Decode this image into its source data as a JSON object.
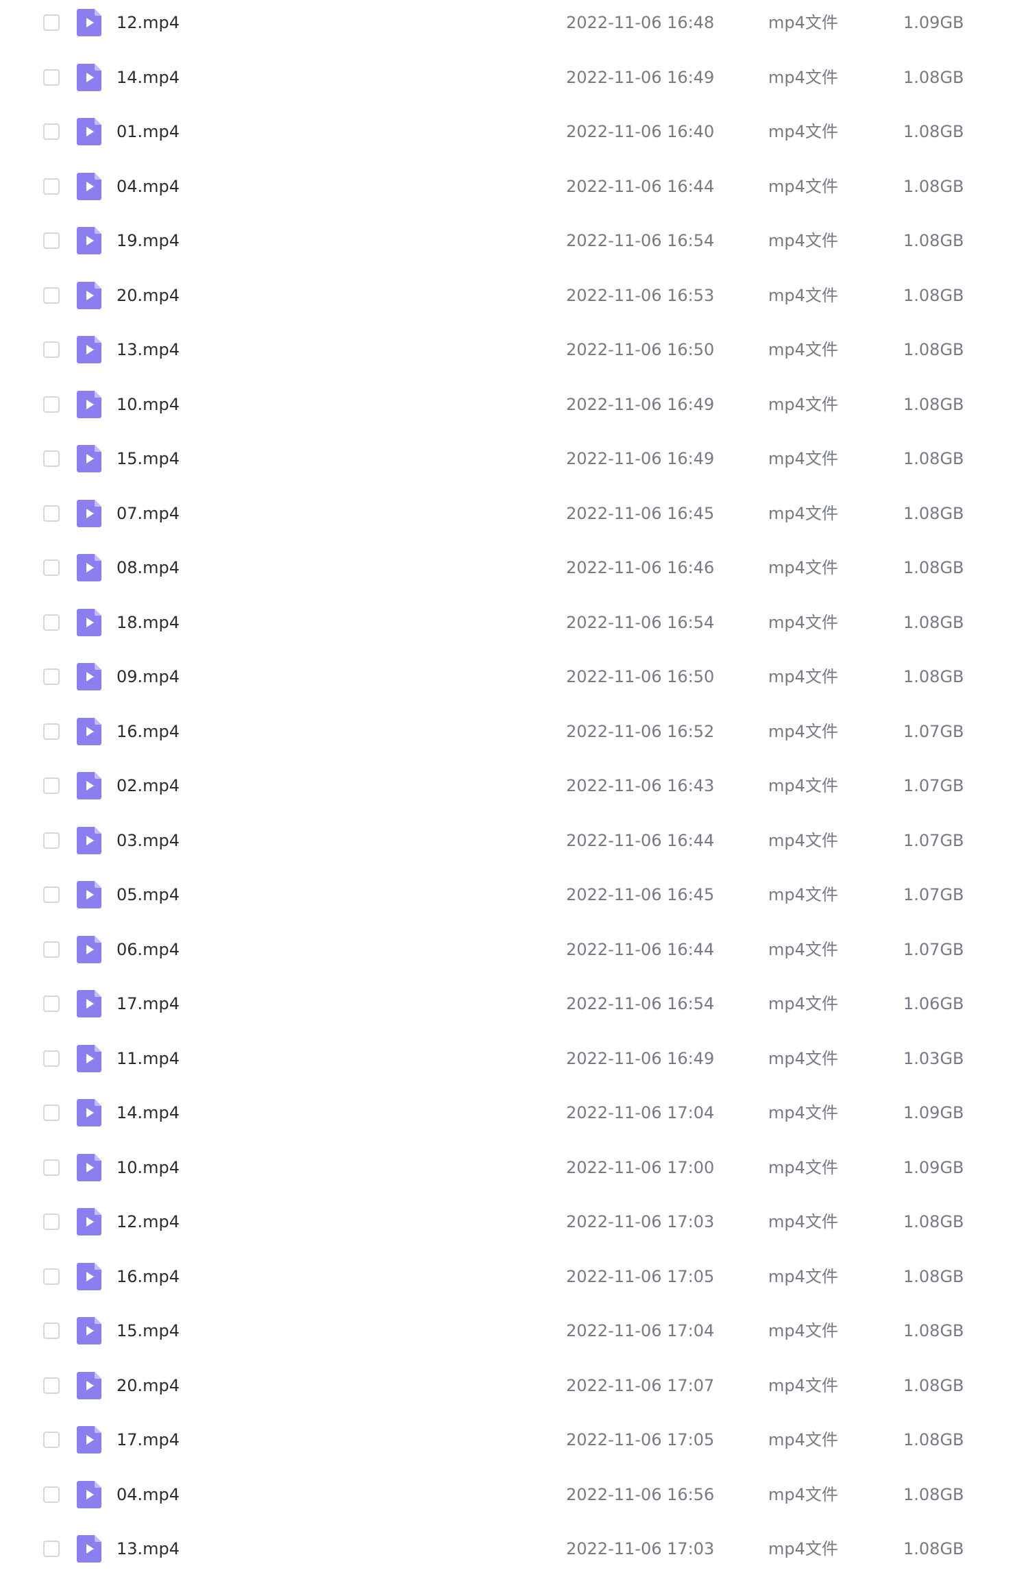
{
  "theme": {
    "icon_color": "#8b7ff0",
    "icon_fold_color": "#c3bcf8",
    "name_color": "#2b2c33",
    "meta_color": "#767a85",
    "checkbox_border": "#d6d6da"
  },
  "file_icon": "video-file-icon",
  "files": [
    {
      "name": "12.mp4",
      "modified": "2022-11-06 16:48",
      "type": "mp4文件",
      "size": "1.09GB"
    },
    {
      "name": "14.mp4",
      "modified": "2022-11-06 16:49",
      "type": "mp4文件",
      "size": "1.08GB"
    },
    {
      "name": "01.mp4",
      "modified": "2022-11-06 16:40",
      "type": "mp4文件",
      "size": "1.08GB"
    },
    {
      "name": "04.mp4",
      "modified": "2022-11-06 16:44",
      "type": "mp4文件",
      "size": "1.08GB"
    },
    {
      "name": "19.mp4",
      "modified": "2022-11-06 16:54",
      "type": "mp4文件",
      "size": "1.08GB"
    },
    {
      "name": "20.mp4",
      "modified": "2022-11-06 16:53",
      "type": "mp4文件",
      "size": "1.08GB"
    },
    {
      "name": "13.mp4",
      "modified": "2022-11-06 16:50",
      "type": "mp4文件",
      "size": "1.08GB"
    },
    {
      "name": "10.mp4",
      "modified": "2022-11-06 16:49",
      "type": "mp4文件",
      "size": "1.08GB"
    },
    {
      "name": "15.mp4",
      "modified": "2022-11-06 16:49",
      "type": "mp4文件",
      "size": "1.08GB"
    },
    {
      "name": "07.mp4",
      "modified": "2022-11-06 16:45",
      "type": "mp4文件",
      "size": "1.08GB"
    },
    {
      "name": "08.mp4",
      "modified": "2022-11-06 16:46",
      "type": "mp4文件",
      "size": "1.08GB"
    },
    {
      "name": "18.mp4",
      "modified": "2022-11-06 16:54",
      "type": "mp4文件",
      "size": "1.08GB"
    },
    {
      "name": "09.mp4",
      "modified": "2022-11-06 16:50",
      "type": "mp4文件",
      "size": "1.08GB"
    },
    {
      "name": "16.mp4",
      "modified": "2022-11-06 16:52",
      "type": "mp4文件",
      "size": "1.07GB"
    },
    {
      "name": "02.mp4",
      "modified": "2022-11-06 16:43",
      "type": "mp4文件",
      "size": "1.07GB"
    },
    {
      "name": "03.mp4",
      "modified": "2022-11-06 16:44",
      "type": "mp4文件",
      "size": "1.07GB"
    },
    {
      "name": "05.mp4",
      "modified": "2022-11-06 16:45",
      "type": "mp4文件",
      "size": "1.07GB"
    },
    {
      "name": "06.mp4",
      "modified": "2022-11-06 16:44",
      "type": "mp4文件",
      "size": "1.07GB"
    },
    {
      "name": "17.mp4",
      "modified": "2022-11-06 16:54",
      "type": "mp4文件",
      "size": "1.06GB"
    },
    {
      "name": "11.mp4",
      "modified": "2022-11-06 16:49",
      "type": "mp4文件",
      "size": "1.03GB"
    },
    {
      "name": "14.mp4",
      "modified": "2022-11-06 17:04",
      "type": "mp4文件",
      "size": "1.09GB"
    },
    {
      "name": "10.mp4",
      "modified": "2022-11-06 17:00",
      "type": "mp4文件",
      "size": "1.09GB"
    },
    {
      "name": "12.mp4",
      "modified": "2022-11-06 17:03",
      "type": "mp4文件",
      "size": "1.08GB"
    },
    {
      "name": "16.mp4",
      "modified": "2022-11-06 17:05",
      "type": "mp4文件",
      "size": "1.08GB"
    },
    {
      "name": "15.mp4",
      "modified": "2022-11-06 17:04",
      "type": "mp4文件",
      "size": "1.08GB"
    },
    {
      "name": "20.mp4",
      "modified": "2022-11-06 17:07",
      "type": "mp4文件",
      "size": "1.08GB"
    },
    {
      "name": "17.mp4",
      "modified": "2022-11-06 17:05",
      "type": "mp4文件",
      "size": "1.08GB"
    },
    {
      "name": "04.mp4",
      "modified": "2022-11-06 16:56",
      "type": "mp4文件",
      "size": "1.08GB"
    },
    {
      "name": "13.mp4",
      "modified": "2022-11-06 17:03",
      "type": "mp4文件",
      "size": "1.08GB"
    }
  ]
}
